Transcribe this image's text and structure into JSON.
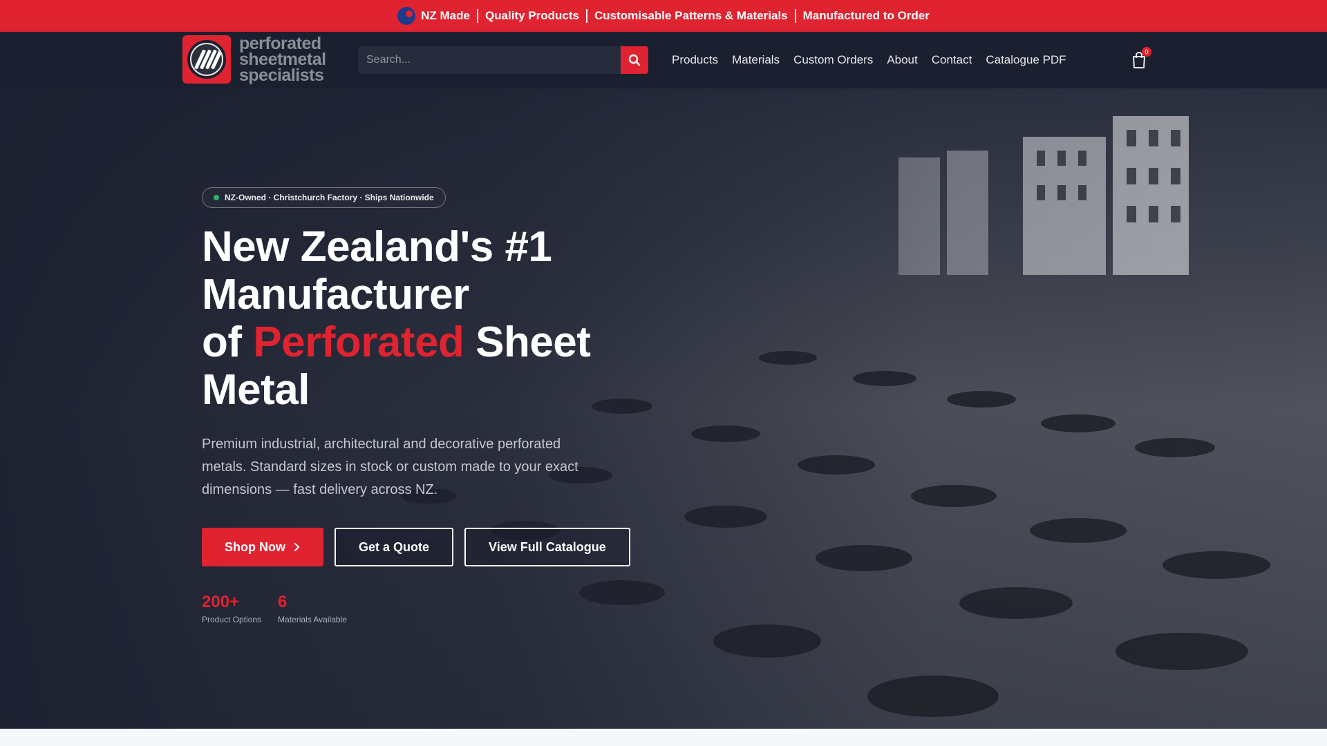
{
  "announcement": {
    "items": [
      "NZ Made",
      "Quality Products",
      "Customisable Patterns & Materials",
      "Manufactured to Order"
    ]
  },
  "header": {
    "logo_lines": [
      "perforated",
      "sheetmetal",
      "specialists"
    ],
    "search_placeholder": "Search...",
    "nav": [
      "Products",
      "Materials",
      "Custom Orders",
      "About",
      "Contact",
      "Catalogue PDF"
    ],
    "cart_count": "0"
  },
  "hero": {
    "pill": "NZ-Owned · Christchurch Factory · Ships Nationwide",
    "title_line1": "New Zealand's #1",
    "title_line2": "Manufacturer",
    "title_of": "of",
    "title_accent": "Perforated",
    "title_sheet": "Sheet",
    "title_line4": "Metal",
    "lead": "Premium industrial, architectural and decorative perforated metals. Standard sizes in stock or custom made to your exact dimensions — fast delivery across NZ.",
    "cta_shop": "Shop Now",
    "cta_quote": "Get a Quote",
    "cta_catalogue": "View Full Catalogue",
    "stats": [
      {
        "value": "200+",
        "label": "Product Options"
      },
      {
        "value": "6",
        "label": "Materials Available"
      }
    ]
  },
  "colors": {
    "brand_red": "#e02330",
    "header_bg": "#1b2030",
    "status_green": "#2fb06c"
  }
}
